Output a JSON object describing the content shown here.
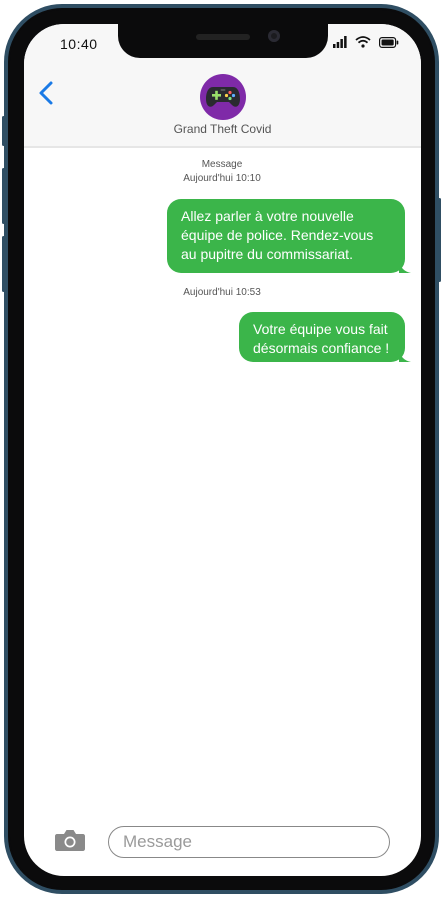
{
  "status_bar": {
    "time": "10:40"
  },
  "header": {
    "contact_name": "Grand Theft Covid",
    "avatar_icon": "gamepad-icon",
    "back_icon": "chevron-left-icon"
  },
  "conversation": {
    "service_label": "Message",
    "messages": [
      {
        "timestamp": "Aujourd'hui 10:10",
        "lines": [
          "Allez parler à votre nouvelle",
          "équipe de police. Rendez-vous",
          "au pupitre du commissariat."
        ]
      },
      {
        "timestamp": "Aujourd'hui 10:53",
        "lines": [
          "Votre équipe vous fait",
          "désormais confiance !"
        ]
      }
    ]
  },
  "composer": {
    "placeholder": "Message",
    "camera_icon": "camera-icon"
  },
  "colors": {
    "bubble": "#3bb54a",
    "frame": "#2f4e63",
    "accent": "#1a7ae6",
    "avatar": "#7f2aa8"
  }
}
